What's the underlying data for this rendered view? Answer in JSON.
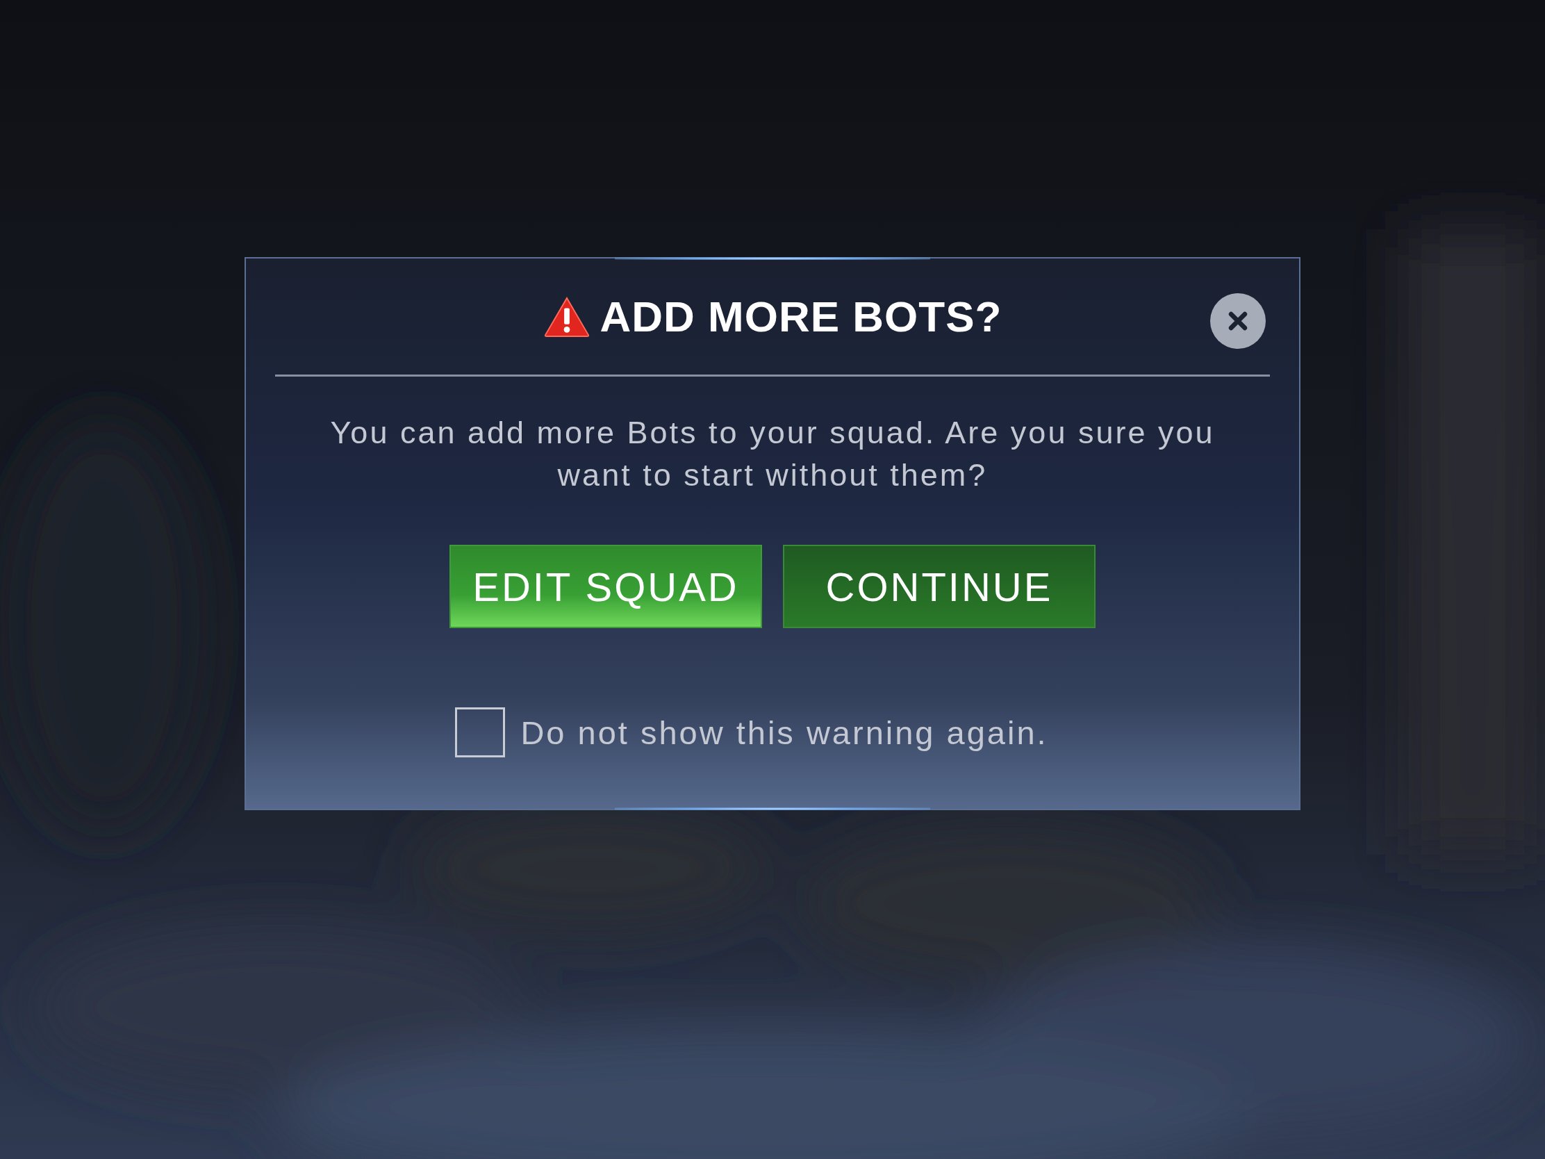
{
  "dialog": {
    "title": "ADD MORE BOTS?",
    "message": "You can add more Bots to your squad. Are you sure you want to start without them?",
    "buttons": [
      {
        "label": "EDIT SQUAD",
        "kind": "primary"
      },
      {
        "label": "CONTINUE",
        "kind": "secondary"
      }
    ],
    "checkbox": {
      "label": "Do not show this warning again.",
      "checked": false
    }
  }
}
